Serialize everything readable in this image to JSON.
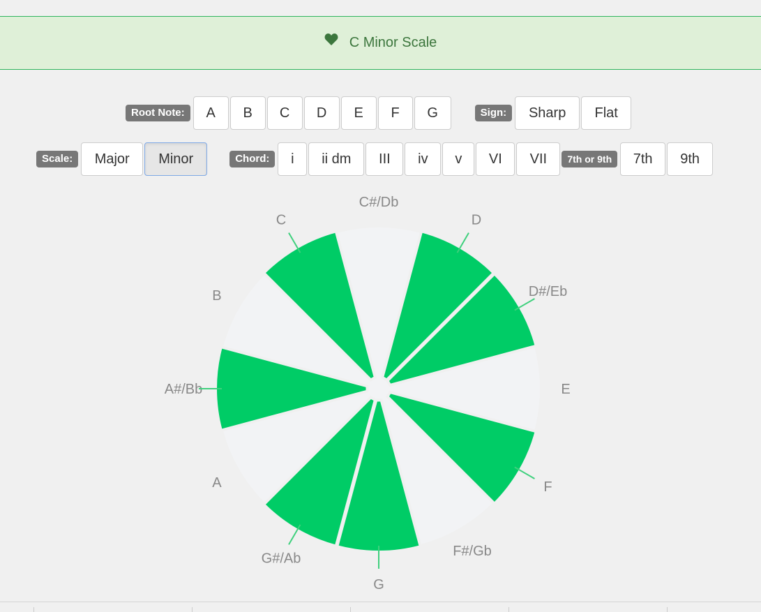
{
  "banner": {
    "title": "C Minor Scale",
    "icon": "heart-icon",
    "color": "#3c763d"
  },
  "root_note": {
    "label": "Root Note:",
    "options": [
      "A",
      "B",
      "C",
      "D",
      "E",
      "F",
      "G"
    ]
  },
  "sign": {
    "label": "Sign:",
    "options": [
      "Sharp",
      "Flat"
    ]
  },
  "scale": {
    "label": "Scale:",
    "options": [
      "Major",
      "Minor"
    ],
    "selected": "Minor"
  },
  "chord": {
    "label": "Chord:",
    "options": [
      "i",
      "ii dm",
      "III",
      "iv",
      "v",
      "VI",
      "VII"
    ]
  },
  "extension": {
    "label": "7th or 9th",
    "options": [
      "7th",
      "9th"
    ]
  },
  "chart_data": {
    "type": "pie",
    "subtype": "polar-area",
    "accent": "#00cc66",
    "background_disc": "#f2f3f5",
    "categories": [
      "C#/Db",
      "D",
      "D#/Eb",
      "E",
      "F",
      "F#/Gb",
      "G",
      "G#/Ab",
      "A",
      "A#/Bb",
      "B",
      "C"
    ],
    "in_scale": [
      0,
      1,
      1,
      0,
      1,
      0,
      1,
      1,
      0,
      1,
      0,
      1
    ]
  }
}
